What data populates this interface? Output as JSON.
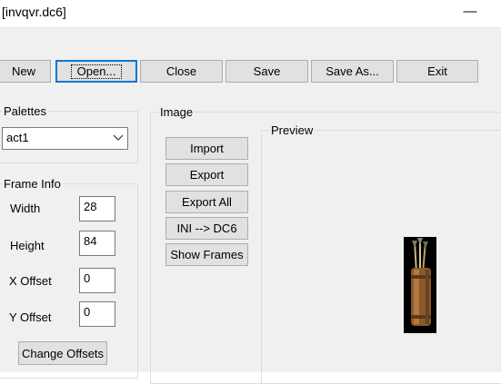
{
  "window": {
    "title": "[invqvr.dc6]",
    "minimize_glyph": "—"
  },
  "toolbar": {
    "new_label": "New",
    "open_label": "Open...",
    "close_label": "Close",
    "save_label": "Save",
    "save_as_label": "Save As...",
    "exit_label": "Exit"
  },
  "palettes": {
    "legend": "Palettes",
    "selected": "act1"
  },
  "frame_info": {
    "legend": "Frame Info",
    "width_label": "Width",
    "width_value": "28",
    "height_label": "Height",
    "height_value": "84",
    "x_offset_label": "X Offset",
    "x_offset_value": "0",
    "y_offset_label": "Y Offset",
    "y_offset_value": "0",
    "change_offsets_label": "Change Offsets"
  },
  "image": {
    "legend": "Image",
    "import_label": "Import",
    "export_label": "Export",
    "export_all_label": "Export All",
    "ini_dc6_label": "INI --> DC6",
    "show_frames_label": "Show Frames",
    "preview_legend": "Preview"
  }
}
